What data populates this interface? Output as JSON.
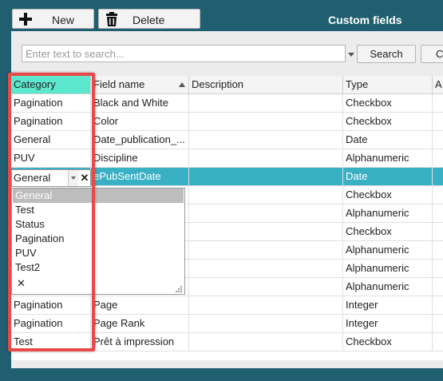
{
  "toolbar": {
    "new_label": "New",
    "delete_label": "Delete",
    "title": "Custom fields"
  },
  "search": {
    "placeholder": "Enter text to search...",
    "search_label": "Search",
    "clear_label": "Cle"
  },
  "grid": {
    "columns": [
      "Category",
      "Field name",
      "Description",
      "Type",
      "A"
    ],
    "sort": {
      "column": "Field name",
      "direction": "ascending"
    },
    "rows": [
      {
        "category": "Pagination",
        "field": "Black and White",
        "description": "",
        "type": "Checkbox"
      },
      {
        "category": "Pagination",
        "field": "Color",
        "description": "",
        "type": "Checkbox"
      },
      {
        "category": "General",
        "field": "Date_publication_...",
        "description": "",
        "type": "Date"
      },
      {
        "category": "PUV",
        "field": "Discipline",
        "description": "",
        "type": "Alphanumeric"
      },
      {
        "category": "General",
        "field": "ePubSentDate",
        "description": "",
        "type": "Date",
        "selected": true
      },
      {
        "category": "",
        "field": "",
        "description": "",
        "type": "Checkbox"
      },
      {
        "category": "",
        "field": "",
        "description": "",
        "type": "Alphanumeric"
      },
      {
        "category": "",
        "field": "",
        "description": "",
        "type": "Checkbox"
      },
      {
        "category": "",
        "field": "",
        "description": "",
        "type": "Alphanumeric"
      },
      {
        "category": "",
        "field": "",
        "description": "",
        "type": "Alphanumeric"
      },
      {
        "category": "",
        "field": "",
        "description": "",
        "type": "Alphanumeric"
      },
      {
        "category": "Pagination",
        "field": "Page",
        "description": "",
        "type": "Integer"
      },
      {
        "category": "Pagination",
        "field": "Page Rank",
        "description": "",
        "type": "Integer"
      },
      {
        "category": "Test",
        "field": "Prêt à impression",
        "description": "",
        "type": "Checkbox"
      }
    ]
  },
  "category_editor": {
    "value": "General",
    "clear_glyph": "✕",
    "options": [
      "General",
      "Test",
      "Status",
      "Pagination",
      "PUV",
      "Test2"
    ],
    "highlighted": "General",
    "clear_option_glyph": "✕"
  },
  "colors": {
    "header_bar": "#1f5f70",
    "selected_row": "#3ab0c4",
    "category_header": "#5ce8cf",
    "callout_border": "#e84a4a"
  },
  "icons": [
    "plus-icon",
    "trash-icon",
    "sort-ascending-icon",
    "dropdown-arrow-icon",
    "clear-icon",
    "resize-grip-icon"
  ]
}
